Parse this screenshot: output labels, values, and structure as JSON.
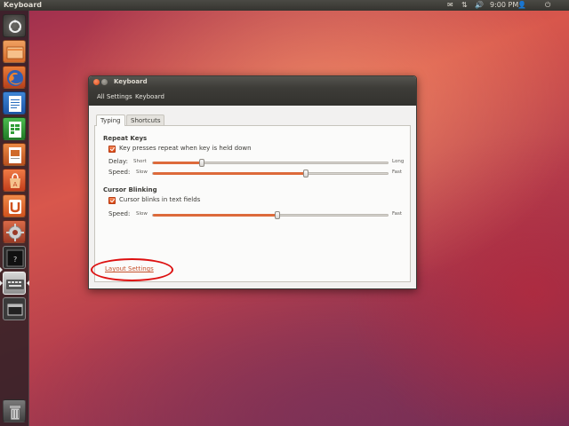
{
  "top_panel": {
    "title": "Keyboard",
    "clock": "9:00 PM"
  },
  "launcher": {
    "items": [
      {
        "name": "dash-home-icon",
        "color": "#5a5855"
      },
      {
        "name": "home-folder-icon",
        "color": "#e6863f"
      },
      {
        "name": "firefox-icon",
        "color": "#e15d27"
      },
      {
        "name": "libreoffice-writer-icon",
        "color": "#2b6ebf"
      },
      {
        "name": "libreoffice-calc-icon",
        "color": "#2f9c36"
      },
      {
        "name": "libreoffice-impress-icon",
        "color": "#cf6a2b"
      },
      {
        "name": "software-center-icon",
        "color": "#d9542a"
      },
      {
        "name": "ubuntu-one-icon",
        "color": "#e36f2a"
      },
      {
        "name": "system-settings-icon",
        "color": "#c85a3a"
      },
      {
        "name": "terminal-icon",
        "color": "#2d2d2d"
      },
      {
        "name": "keyboard-settings-icon",
        "color": "#9a9a9a"
      },
      {
        "name": "workspace-switcher-icon",
        "color": "#4a4a4a"
      },
      {
        "name": "trash-icon",
        "color": "#6b6b6b"
      }
    ]
  },
  "window": {
    "title": "Keyboard",
    "toolbar": {
      "all_settings": "All Settings",
      "keyboard": "Keyboard"
    },
    "tabs": [
      {
        "label": "Typing",
        "active": true
      },
      {
        "label": "Shortcuts",
        "active": false
      }
    ],
    "repeat_keys": {
      "title": "Repeat Keys",
      "checkbox_label": "Key presses repeat when key is held down",
      "checked": true,
      "delay": {
        "label": "Delay:",
        "min_label": "Short",
        "max_label": "Long",
        "value": 0.21
      },
      "speed": {
        "label": "Speed:",
        "min_label": "Slow",
        "max_label": "Fast",
        "value": 0.65
      }
    },
    "cursor_blinking": {
      "title": "Cursor Blinking",
      "checkbox_label": "Cursor blinks in text fields",
      "checked": true,
      "speed": {
        "label": "Speed:",
        "min_label": "Slow",
        "max_label": "Fast",
        "value": 0.53
      }
    },
    "layout_link": "Layout Settings"
  },
  "colors": {
    "accent": "#dd4814",
    "highlight": "#dd1010",
    "panel": "#3c3b37"
  }
}
